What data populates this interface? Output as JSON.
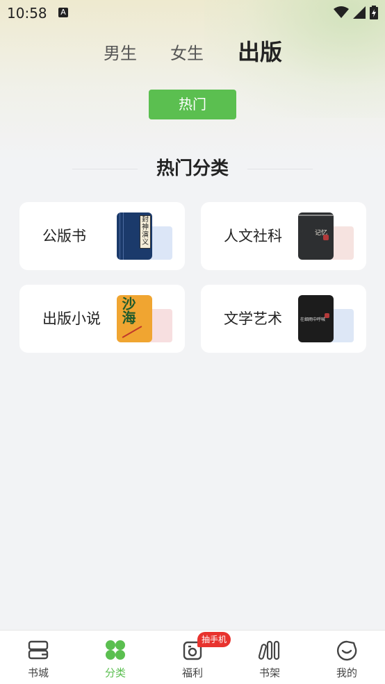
{
  "status": {
    "time": "10:58",
    "notification_letter": "A"
  },
  "tabs": [
    {
      "label": "男生"
    },
    {
      "label": "女生"
    },
    {
      "label": "出版"
    }
  ],
  "hot_button": "热门",
  "section_title": "热门分类",
  "categories": [
    {
      "label": "公版书",
      "cover_text": "封神演义",
      "cover_color": "#1b3a6b",
      "back_color": "#dce6f7"
    },
    {
      "label": "人文社科",
      "cover_text": "记忆",
      "cover_color": "#2d2f31",
      "back_color": "#f6e3e0"
    },
    {
      "label": "出版小说",
      "cover_text": "沙海",
      "cover_color": "#f0a531",
      "back_color": "#f7dfe0"
    },
    {
      "label": "文学艺术",
      "cover_text": "在细雨中呼喊",
      "cover_color": "#1c1c1c",
      "back_color": "#dde7f6"
    }
  ],
  "nav": [
    {
      "label": "书城",
      "icon": "bookstore-icon"
    },
    {
      "label": "分类",
      "icon": "category-icon"
    },
    {
      "label": "福利",
      "icon": "welfare-icon",
      "badge": "抽手机"
    },
    {
      "label": "书架",
      "icon": "bookshelf-icon"
    },
    {
      "label": "我的",
      "icon": "profile-icon"
    }
  ],
  "colors": {
    "accent": "#5bbf50",
    "badge": "#e8332e"
  }
}
